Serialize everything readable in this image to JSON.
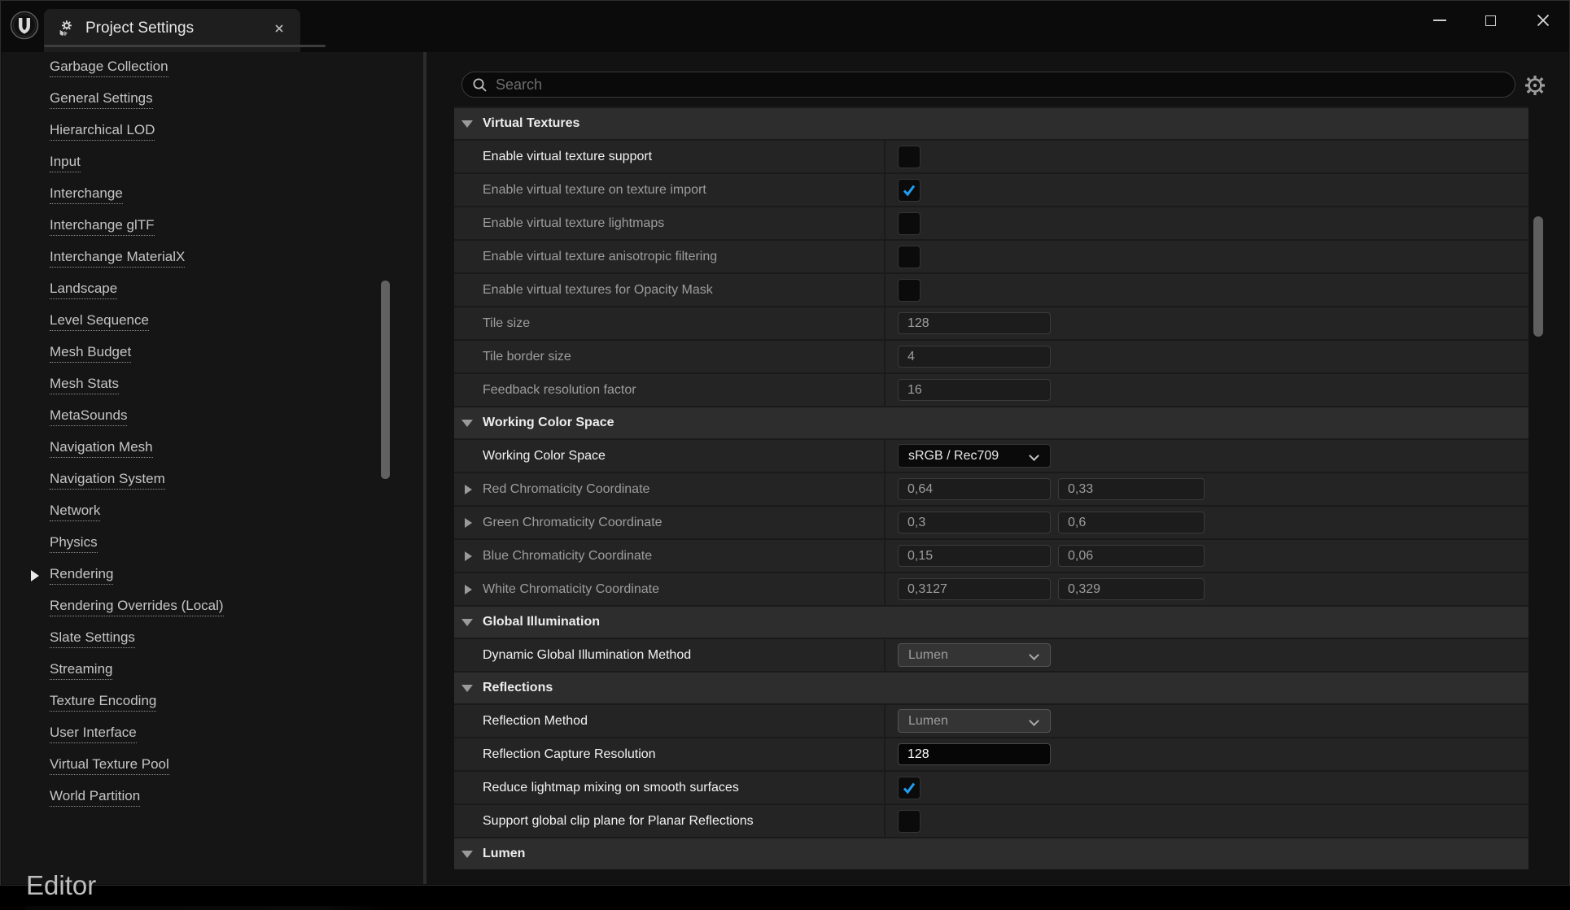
{
  "window": {
    "tab_title": "Project Settings",
    "controls": [
      "minimize",
      "maximize",
      "close"
    ]
  },
  "colors": {
    "accent_blue": "#219ff3",
    "row_bg": "#242424",
    "header_bg": "#2d2d2d"
  },
  "search": {
    "placeholder": "Search"
  },
  "sidebar": {
    "footer_heading": "Editor",
    "items": [
      {
        "label": "Garbage Collection",
        "selected": false
      },
      {
        "label": "General Settings",
        "selected": false
      },
      {
        "label": "Hierarchical LOD",
        "selected": false
      },
      {
        "label": "Input",
        "selected": false
      },
      {
        "label": "Interchange",
        "selected": false
      },
      {
        "label": "Interchange glTF",
        "selected": false
      },
      {
        "label": "Interchange MaterialX",
        "selected": false
      },
      {
        "label": "Landscape",
        "selected": false
      },
      {
        "label": "Level Sequence",
        "selected": false
      },
      {
        "label": "Mesh Budget",
        "selected": false
      },
      {
        "label": "Mesh Stats",
        "selected": false
      },
      {
        "label": "MetaSounds",
        "selected": false
      },
      {
        "label": "Navigation Mesh",
        "selected": false
      },
      {
        "label": "Navigation System",
        "selected": false
      },
      {
        "label": "Network",
        "selected": false
      },
      {
        "label": "Physics",
        "selected": false
      },
      {
        "label": "Rendering",
        "selected": true
      },
      {
        "label": "Rendering Overrides (Local)",
        "selected": false
      },
      {
        "label": "Slate Settings",
        "selected": false
      },
      {
        "label": "Streaming",
        "selected": false
      },
      {
        "label": "Texture Encoding",
        "selected": false
      },
      {
        "label": "User Interface",
        "selected": false
      },
      {
        "label": "Virtual Texture Pool",
        "selected": false
      },
      {
        "label": "World Partition",
        "selected": false
      }
    ]
  },
  "sections": [
    {
      "title": "Virtual Textures",
      "rows": [
        {
          "label": "Enable virtual texture support",
          "type": "checkbox",
          "checked": false,
          "modified": true
        },
        {
          "label": "Enable virtual texture on texture import",
          "type": "checkbox",
          "checked": true,
          "modified": false
        },
        {
          "label": "Enable virtual texture lightmaps",
          "type": "checkbox",
          "checked": false,
          "modified": false
        },
        {
          "label": "Enable virtual texture anisotropic filtering",
          "type": "checkbox",
          "checked": false,
          "modified": false
        },
        {
          "label": "Enable virtual textures for Opacity Mask",
          "type": "checkbox",
          "checked": false,
          "modified": false
        },
        {
          "label": "Tile size",
          "type": "text",
          "value": "128",
          "modified": false
        },
        {
          "label": "Tile border size",
          "type": "text",
          "value": "4",
          "modified": false
        },
        {
          "label": "Feedback resolution factor",
          "type": "text",
          "value": "16",
          "modified": false
        }
      ]
    },
    {
      "title": "Working Color Space",
      "rows": [
        {
          "label": "Working Color Space",
          "type": "dropdown",
          "value": "sRGB / Rec709",
          "style": "dark",
          "modified": true
        },
        {
          "label": "Red Chromaticity Coordinate",
          "type": "text2",
          "values": [
            "0,64",
            "0,33"
          ],
          "expandable": true,
          "modified": false
        },
        {
          "label": "Green Chromaticity Coordinate",
          "type": "text2",
          "values": [
            "0,3",
            "0,6"
          ],
          "expandable": true,
          "modified": false
        },
        {
          "label": "Blue Chromaticity Coordinate",
          "type": "text2",
          "values": [
            "0,15",
            "0,06"
          ],
          "expandable": true,
          "modified": false
        },
        {
          "label": "White Chromaticity Coordinate",
          "type": "text2",
          "values": [
            "0,3127",
            "0,329"
          ],
          "expandable": true,
          "modified": false
        }
      ]
    },
    {
      "title": "Global Illumination",
      "rows": [
        {
          "label": "Dynamic Global Illumination Method",
          "type": "dropdown",
          "value": "Lumen",
          "style": "gray",
          "modified": true
        }
      ]
    },
    {
      "title": "Reflections",
      "rows": [
        {
          "label": "Reflection Method",
          "type": "dropdown",
          "value": "Lumen",
          "style": "gray",
          "modified": true
        },
        {
          "label": "Reflection Capture Resolution",
          "type": "text",
          "value": "128",
          "style": "darkinput",
          "modified": true
        },
        {
          "label": "Reduce lightmap mixing on smooth surfaces",
          "type": "checkbox",
          "checked": true,
          "modified": true
        },
        {
          "label": "Support global clip plane for Planar Reflections",
          "type": "checkbox",
          "checked": false,
          "modified": true
        }
      ]
    },
    {
      "title": "Lumen",
      "rows": []
    }
  ]
}
